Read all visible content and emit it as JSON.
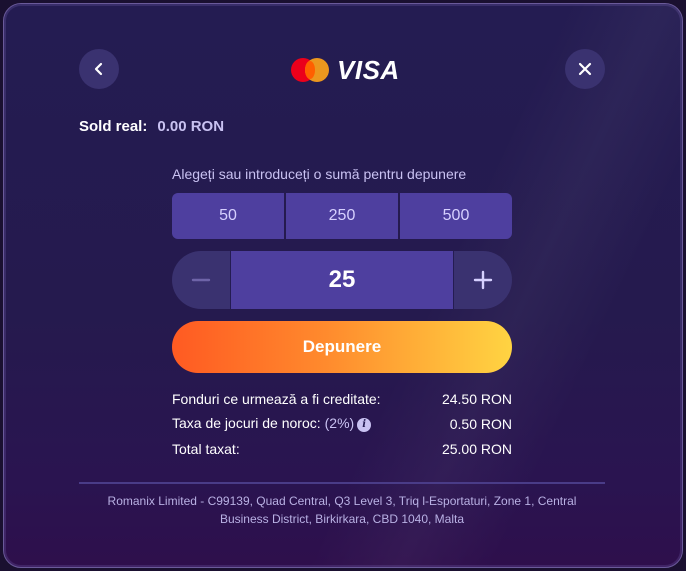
{
  "header": {
    "back_icon": "chevron-left-icon",
    "close_icon": "close-icon",
    "brand_logo_text": "VISA",
    "mastercard_colors": [
      "#eb001b",
      "#f79e1b"
    ]
  },
  "balance": {
    "label": "Sold real:",
    "value": "0.00 RON"
  },
  "amount": {
    "prompt": "Alegeți sau introduceți o sumă pentru depunere",
    "presets": [
      "50",
      "250",
      "500"
    ],
    "minus_label": "−",
    "plus_label": "+",
    "current_value": "25"
  },
  "deposit_button": {
    "label": "Depunere",
    "gradient": [
      "#ff5a22",
      "#ffd442"
    ]
  },
  "summary": {
    "funds_label": "Fonduri ce urmează a fi creditate:",
    "funds_value": "24.50 RON",
    "tax_label": "Taxa de jocuri de noroc:",
    "tax_percent": "(2%)",
    "tax_value": "0.50 RON",
    "total_label": "Total taxat:",
    "total_value": "25.00 RON"
  },
  "footer": {
    "line1": "Romanix Limited - C99139, Quad Central, Q3 Level 3, Triq l-Esportaturi, Zone 1, Central",
    "line2": "Business District, Birkirkara, CBD 1040, Malta"
  },
  "colors": {
    "background": "#241c52",
    "preset_bg": "#4e3f9f",
    "secondary_text": "#c9c2f2"
  }
}
